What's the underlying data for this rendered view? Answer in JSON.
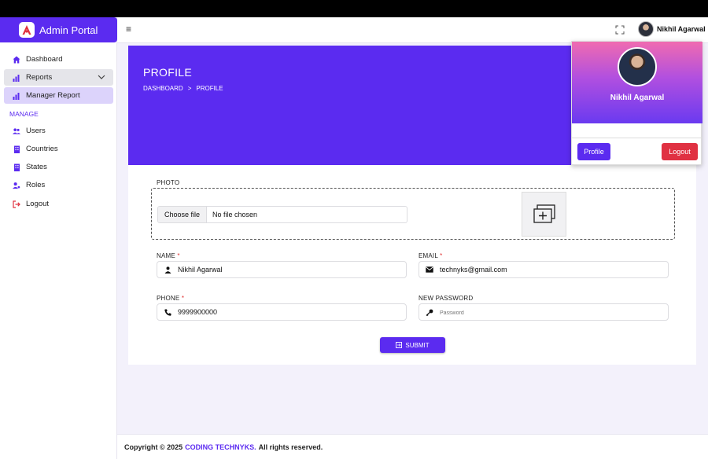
{
  "app": {
    "title": "Admin Portal"
  },
  "header": {
    "username": "Nikhil Agarwal"
  },
  "sidebar": {
    "items": [
      {
        "label": "Dashboard",
        "icon": "home-icon"
      },
      {
        "label": "Reports",
        "icon": "bar-chart-icon"
      },
      {
        "label": "Manager Report",
        "icon": "bar-chart-icon"
      },
      {
        "label": "Users",
        "icon": "users-icon"
      },
      {
        "label": "Countries",
        "icon": "building-icon"
      },
      {
        "label": "States",
        "icon": "building-icon"
      },
      {
        "label": "Roles",
        "icon": "user-gear-icon"
      },
      {
        "label": "Logout",
        "icon": "logout-icon"
      }
    ],
    "section_label": "MANAGE"
  },
  "page": {
    "title": "PROFILE",
    "breadcrumb": [
      "DASHBOARD",
      ">",
      "PROFILE"
    ]
  },
  "form": {
    "photo": {
      "label": "PHOTO",
      "button": "Choose file",
      "status": "No file chosen"
    },
    "name": {
      "label": "NAME",
      "value": "Nikhil Agarwal"
    },
    "email": {
      "label": "EMAIL",
      "value": "technyks@gmail.com"
    },
    "phone": {
      "label": "PHONE",
      "value": "9999900000"
    },
    "password": {
      "label": "NEW PASSWORD",
      "placeholder": "Password"
    },
    "required_mark": "*",
    "submit_label": "SUBMIT"
  },
  "dropdown": {
    "name": "Nikhil Agarwal",
    "profile_label": "Profile",
    "logout_label": "Logout"
  },
  "footer": {
    "prefix": "Copyright © 2025",
    "brand": "CODING TECHNYKS.",
    "suffix": "All rights reserved."
  },
  "colors": {
    "primary": "#5b2bf0",
    "danger": "#e03142"
  }
}
